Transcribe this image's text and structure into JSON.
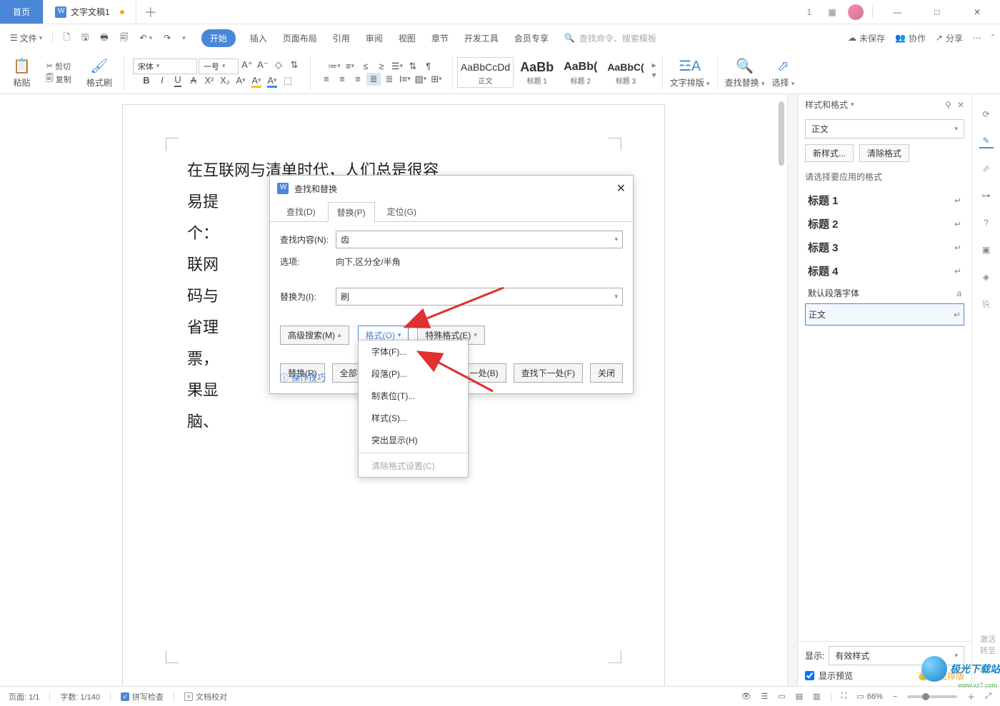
{
  "titlebar": {
    "home": "首页",
    "doc_name": "文字文稿1",
    "badge1": "1",
    "win_min": "—",
    "win_max": "□",
    "win_close": "✕"
  },
  "menubar": {
    "file": "文件",
    "tabs": [
      "开始",
      "插入",
      "页面布局",
      "引用",
      "审阅",
      "视图",
      "章节",
      "开发工具",
      "会员专享"
    ],
    "search_placeholder": "查找命令、搜索模板",
    "unsaved": "未保存",
    "coop": "协作",
    "share": "分享"
  },
  "ribbon": {
    "paste": "粘贴",
    "cut": "剪切",
    "copy": "复制",
    "fmtpaint": "格式刷",
    "font_name": "宋体",
    "font_size": "一号",
    "style_previews": [
      "AaBbCcDd",
      "AaBb",
      "AaBb(",
      "AaBbC("
    ],
    "style_labels": [
      "正文",
      "标题 1",
      "标题 2",
      "标题 3"
    ],
    "text_layout": "文字排版",
    "find_replace": "查找替换",
    "select": "选择"
  },
  "document": {
    "lines": [
      "在互联网与清单时代，人们总是很容",
      "易提",
      "个：",
      "联网",
      "码与",
      "省理",
      "票，",
      "果显",
      "脑、"
    ]
  },
  "dialog": {
    "title": "查找和替换",
    "tabs": {
      "find": "查找(D)",
      "replace": "替换(P)",
      "goto": "定位(G)"
    },
    "find_label": "查找内容(N):",
    "find_value": "齿",
    "options_label": "选项:",
    "options_value": "向下,区分全/半角",
    "replace_label": "替换为(I):",
    "replace_value": "刷",
    "btn_adv": "高级搜索(M)",
    "btn_fmt": "格式(O)",
    "btn_spec": "特殊格式(E)",
    "btn_repl": "替换(R)",
    "btn_repl_all_short": "全部替",
    "btn_prev": "查找上一处(B)",
    "btn_next": "查找下一处(F)",
    "btn_close": "关闭",
    "tips": "操作技巧"
  },
  "fmt_menu": {
    "font": "字体(F)...",
    "para": "段落(P)...",
    "tabs": "制表位(T)...",
    "style": "样式(S)...",
    "highlight": "突出显示(H)",
    "clear": "清除格式设置(C)"
  },
  "sidepanel": {
    "title": "样式和格式",
    "current": "正文",
    "new_style": "新样式...",
    "clear_fmt": "清除格式",
    "prompt": "请选择要应用的格式",
    "items": [
      "标题 1",
      "标题 2",
      "标题 3",
      "标题 4"
    ],
    "default_para": "默认段落字体",
    "normal": "正文",
    "show_label": "显示:",
    "show_value": "有效样式",
    "preview": "显示预览",
    "smart": "智能排版"
  },
  "statusbar": {
    "page": "页面: 1/1",
    "words": "字数: 1/140",
    "spell": "拼写检查",
    "proof": "文档校对",
    "zoom": "66%"
  },
  "watermark": {
    "l1": "激活",
    "l2": "转至"
  }
}
